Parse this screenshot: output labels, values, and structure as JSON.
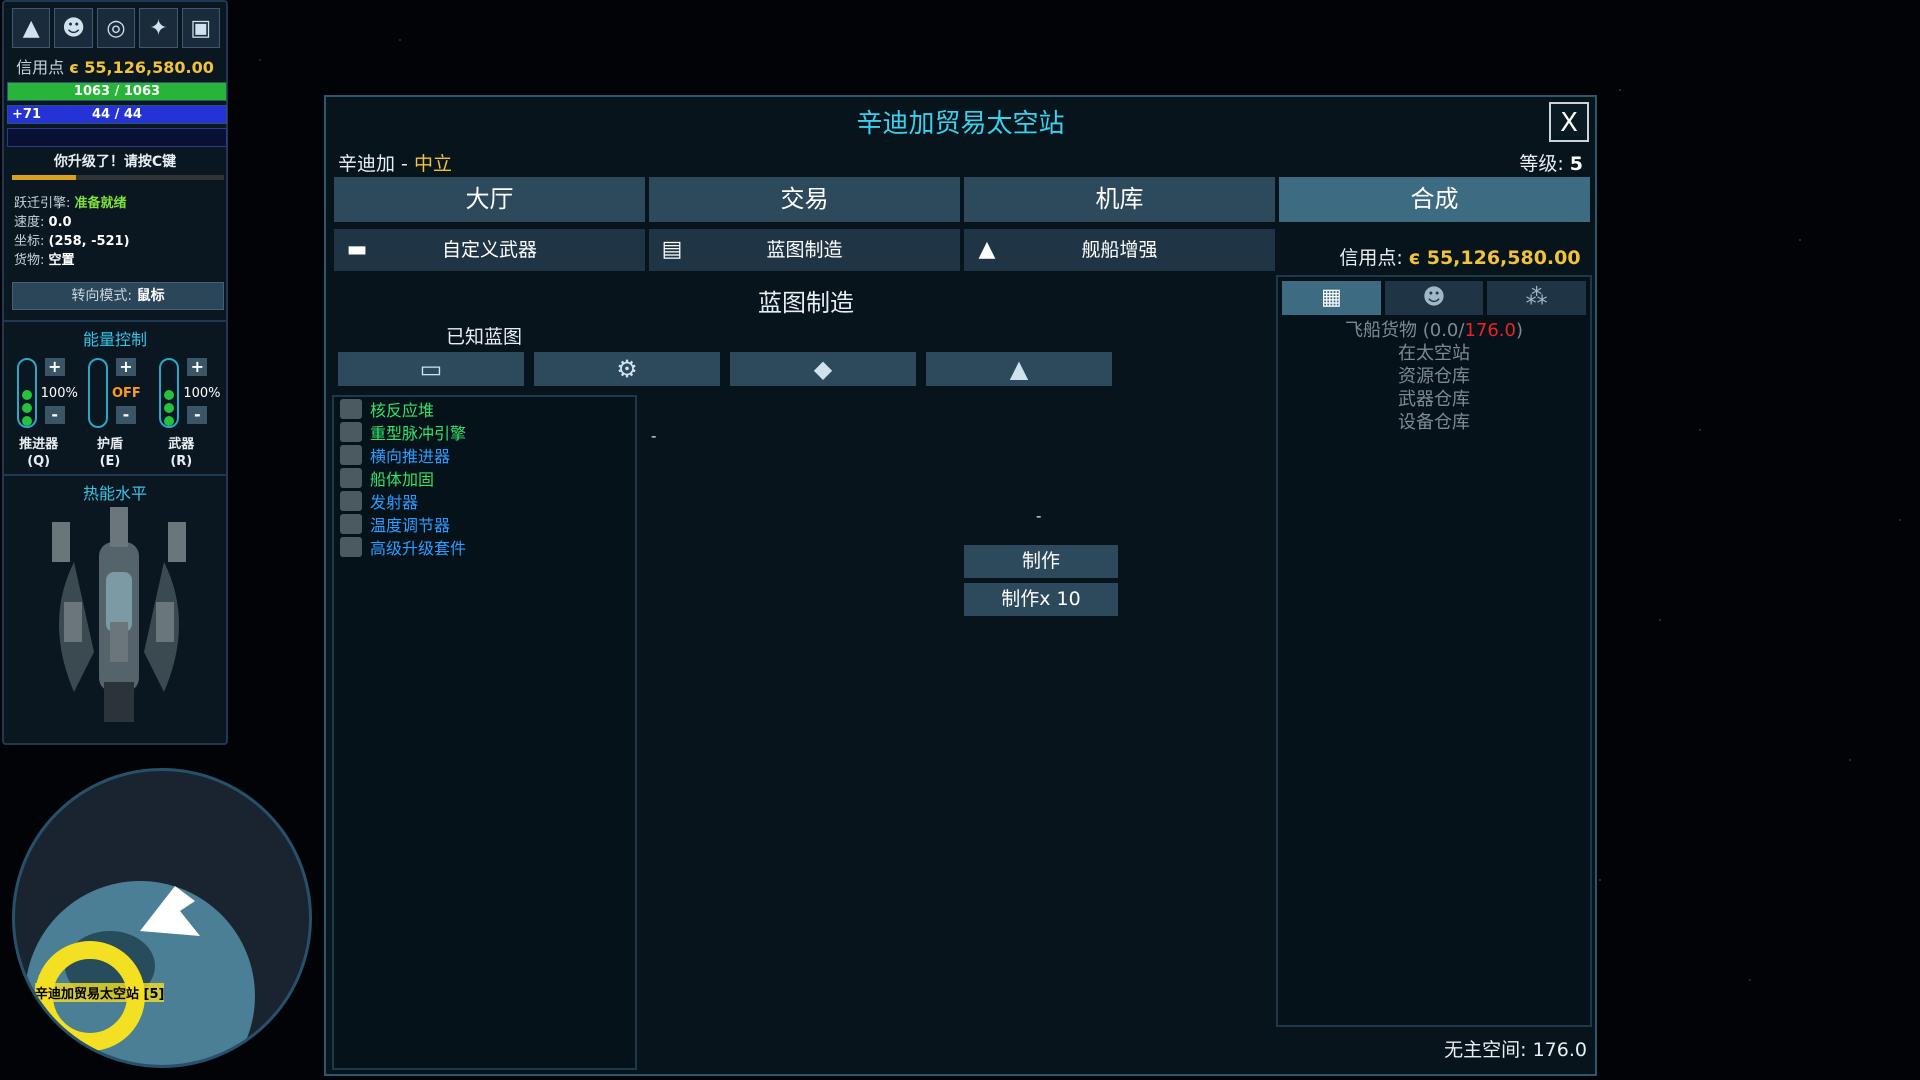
{
  "hud": {
    "icons": [
      "ship-icon",
      "pilot-icon",
      "radar-icon",
      "galaxy-map-icon",
      "codex-icon"
    ],
    "credits_label": "信用点",
    "credits_value": "є 55,126,580.00",
    "hull": "1063 / 1063",
    "energy_bonus": "+71",
    "energy": "44 / 44",
    "levelup_msg": "你升级了！请按C键",
    "xp_progress": 0.3,
    "warp_label": "跃迁引擎:",
    "warp_value": "准备就绪",
    "speed_label": "速度:",
    "speed_value": "0.0",
    "coords_label": "坐标:",
    "coords_value": "(258, -521)",
    "cargo_label": "货物:",
    "cargo_value": "空置",
    "turn_mode_label": "转向模式:",
    "turn_mode_value": "鼠标",
    "energy_control_title": "能量控制",
    "engines": [
      {
        "pct": "100%",
        "name": "推进器",
        "key": "(Q)"
      },
      {
        "pct": "OFF",
        "name": "护盾",
        "key": "(E)"
      },
      {
        "pct": "100%",
        "name": "武器",
        "key": "(R)"
      }
    ],
    "plus": "+",
    "minus": "-",
    "heat_title": "热能水平"
  },
  "minimap": {
    "station_label": "辛迪加贸易太空站 [5]"
  },
  "window": {
    "title": "辛迪加贸易太空站",
    "close": "X",
    "faction_name": "辛迪加",
    "faction_sep": " - ",
    "faction_status": "中立",
    "level_label": "等级:",
    "level_value": "5",
    "tabs": [
      "大厅",
      "交易",
      "机库",
      "合成"
    ],
    "subtabs": [
      "自定义武器",
      "蓝图制造",
      "舰船增强"
    ],
    "credits_label": "信用点:",
    "credits_value": "є 55,126,580.00",
    "section_title": "蓝图制造",
    "known_title": "已知蓝图",
    "filters": [
      "turret-icon",
      "gear-icon",
      "module-icon",
      "ship-icon"
    ],
    "blueprints": [
      {
        "name": "核反应堆",
        "color": "#32e26a"
      },
      {
        "name": "重型脉冲引擎",
        "color": "#32e26a"
      },
      {
        "name": "横向推进器",
        "color": "#2d9cff"
      },
      {
        "name": "船体加固",
        "color": "#32e26a"
      },
      {
        "name": "发射器",
        "color": "#2d9cff"
      },
      {
        "name": "温度调节器",
        "color": "#2d9cff"
      },
      {
        "name": "高级升级套件",
        "color": "#2d9cff"
      }
    ],
    "dash": "-",
    "craft_button": "制作",
    "craft10_button": "制作x 10",
    "cargo_tabs": [
      "cargo-icon",
      "crew-icon",
      "materials-icon"
    ],
    "cargo_ship_label": "飞船货物 (0.0/",
    "cargo_ship_max": "176.0",
    "cargo_ship_close": ")",
    "cargo_items": [
      "在太空站",
      "资源仓库",
      "武器仓库",
      "设备仓库"
    ],
    "free_space": "无主空间: 176.0"
  }
}
